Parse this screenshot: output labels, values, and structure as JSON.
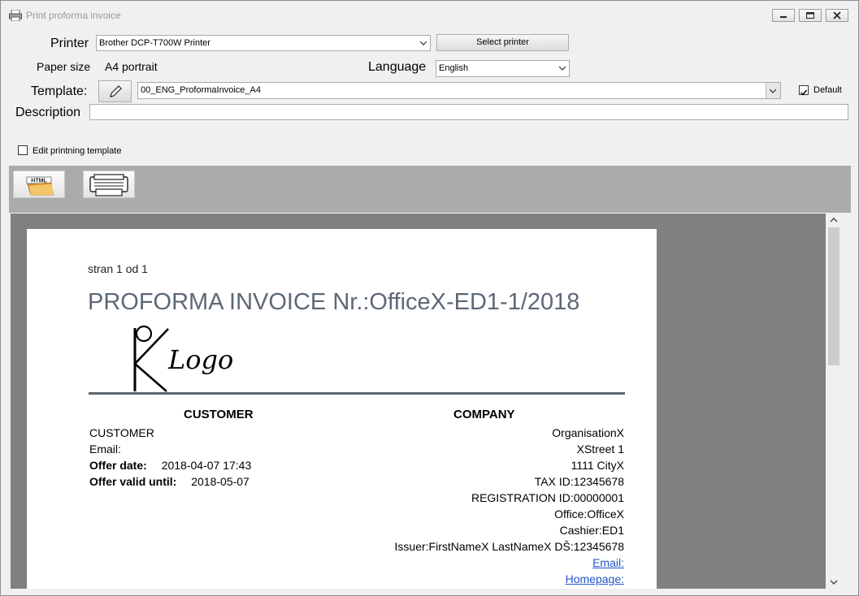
{
  "window": {
    "title": "Print proforma invoice"
  },
  "form": {
    "printer_label": "Printer",
    "printer_value": "Brother DCP-T700W Printer",
    "select_printer_button": "Select printer",
    "paper_size_label": "Paper size",
    "paper_size_value": "A4 portrait",
    "language_label": "Language",
    "language_value": "English",
    "template_label": "Template:",
    "template_value": "00_ENG_ProformaInvoice_A4",
    "default_label": "Default",
    "default_checked": true,
    "description_label": "Description",
    "description_value": "",
    "edit_template_label": "Edit printning template",
    "edit_template_checked": false
  },
  "toolbar": {
    "html_icon_text": "HTML",
    "items": [
      "html-export-icon",
      "printer-icon"
    ]
  },
  "document": {
    "page_info": "stran  1 od 1",
    "title": "PROFORMA INVOICE Nr.:OfficeX-ED1-1/2018",
    "logo_text": "Logo",
    "customer_heading": "CUSTOMER",
    "company_heading": "COMPANY",
    "customer": {
      "name": "CUSTOMER",
      "email_label": "Email:",
      "offer_date_label": "Offer date:",
      "offer_date_value": "2018-04-07 17:43",
      "offer_valid_label": "Offer valid until:",
      "offer_valid_value": "2018-05-07"
    },
    "company": {
      "lines": [
        "OrganisationX",
        "XStreet 1",
        "1111 CityX",
        "TAX ID:12345678",
        "REGISTRATION ID:00000001",
        "Office:OfficeX",
        "Cashier:ED1",
        "Issuer:FirstNameX LastNameX DŠ:12345678"
      ],
      "email_link": "Email:",
      "homepage_link": "Homepage:"
    }
  },
  "colors": {
    "title_color": "#5d6875",
    "link_color": "#2255cc",
    "toolbar_bg": "#ababab",
    "preview_bg": "#808080"
  }
}
